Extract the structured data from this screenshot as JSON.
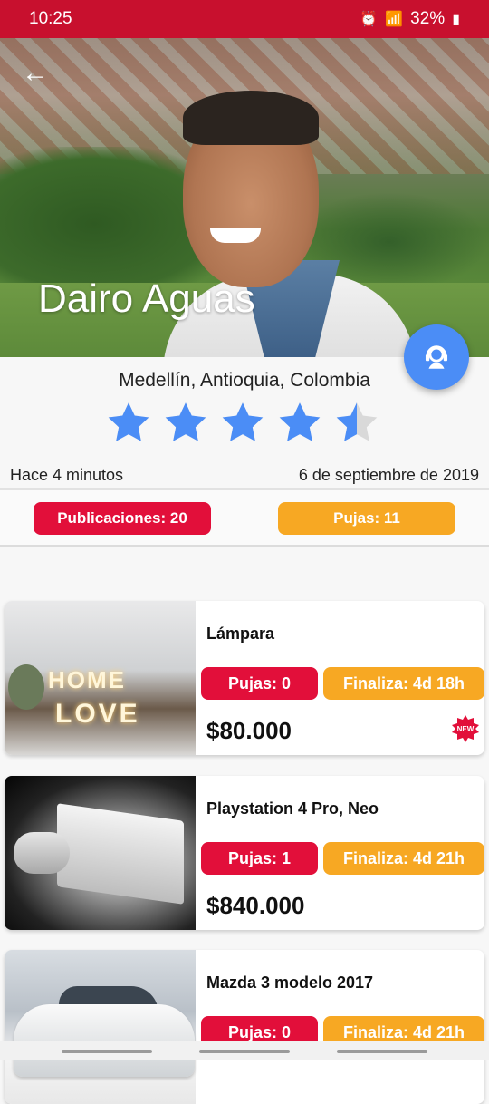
{
  "status_bar": {
    "time": "10:25",
    "battery": "32%"
  },
  "profile": {
    "name": "Dairo Aguas",
    "location": "Medellín, Antioquia, Colombia",
    "rating": 4.5,
    "rating_max": 5,
    "last_seen": "Hace 4 minutos",
    "member_since": "6 de septiembre de 2019"
  },
  "counts": {
    "publications_label": "Publicaciones: 20",
    "bids_label": "Pujas: 11"
  },
  "colors": {
    "brand_red": "#c8102e",
    "badge_red": "#e20f3a",
    "badge_orange": "#f7a823",
    "fab_blue": "#4b8df6",
    "star_blue": "#4b8df6"
  },
  "listings": [
    {
      "title": "Lámpara",
      "bids": "Pujas: 0",
      "ends": "Finaliza: 4d 18h",
      "price": "$80.000",
      "image_text_1": "HOME",
      "image_text_2": "LOVE",
      "new_badge": "NEW"
    },
    {
      "title": "Playstation 4 Pro, Neo",
      "bids": "Pujas: 1",
      "ends": "Finaliza: 4d 21h",
      "price": "$840.000"
    },
    {
      "title": "Mazda 3 modelo 2017",
      "bids": "Pujas: 0",
      "ends": "Finaliza: 4d 21h",
      "price": ""
    }
  ]
}
